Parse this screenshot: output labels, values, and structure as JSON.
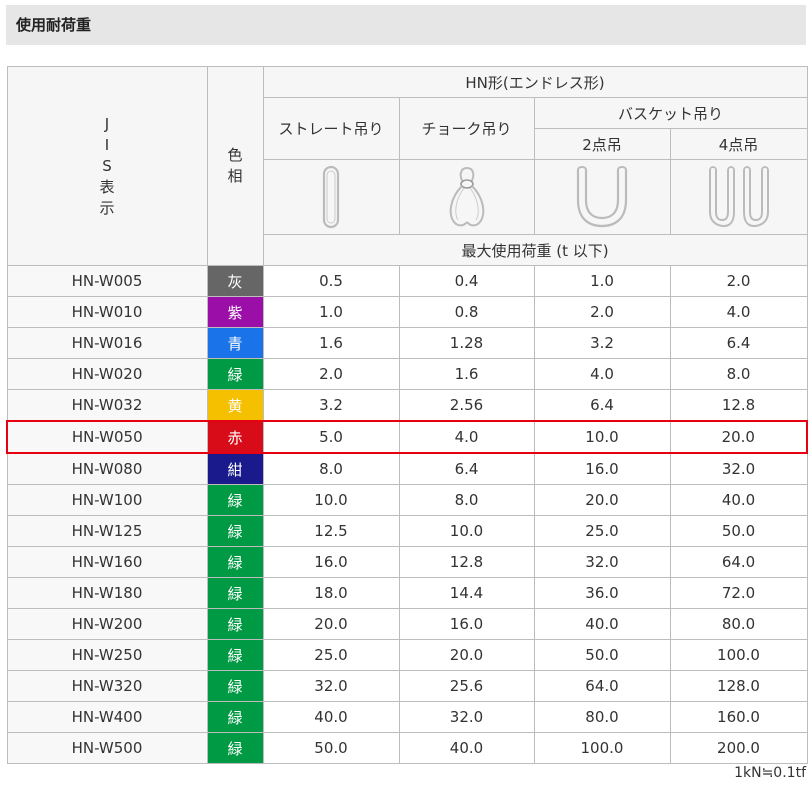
{
  "section": {
    "title": "使用耐荷重"
  },
  "table": {
    "header": {
      "jis_chars": [
        "J",
        "I",
        "S",
        "表",
        "示"
      ],
      "color_chars": [
        "色",
        "相"
      ],
      "group": "HN形(エンドレス形)",
      "straight": "ストレート吊り",
      "choke": "チョーク吊り",
      "basket": "バスケット吊り",
      "two_point": "2点吊",
      "four_point": "4点吊",
      "max_load": "最大使用荷重 (t 以下)"
    },
    "icons": {
      "straight": "straight-sling-icon",
      "choke": "choke-sling-icon",
      "basket2": "basket-two-point-icon",
      "basket4": "basket-four-point-icon"
    },
    "highlight_row": 5,
    "highlight_color": "#e60012",
    "rows": [
      {
        "model": "HN-W005",
        "color": "灰",
        "hex": "#666666",
        "straight": "0.5",
        "choke": "0.4",
        "b2": "1.0",
        "b4": "2.0"
      },
      {
        "model": "HN-W010",
        "color": "紫",
        "hex": "#9b0fa8",
        "straight": "1.0",
        "choke": "0.8",
        "b2": "2.0",
        "b4": "4.0"
      },
      {
        "model": "HN-W016",
        "color": "青",
        "hex": "#1a73e8",
        "straight": "1.6",
        "choke": "1.28",
        "b2": "3.2",
        "b4": "6.4"
      },
      {
        "model": "HN-W020",
        "color": "緑",
        "hex": "#009944",
        "straight": "2.0",
        "choke": "1.6",
        "b2": "4.0",
        "b4": "8.0"
      },
      {
        "model": "HN-W032",
        "color": "黄",
        "hex": "#f5c000",
        "straight": "3.2",
        "choke": "2.56",
        "b2": "6.4",
        "b4": "12.8"
      },
      {
        "model": "HN-W050",
        "color": "赤",
        "hex": "#d80c18",
        "straight": "5.0",
        "choke": "4.0",
        "b2": "10.0",
        "b4": "20.0"
      },
      {
        "model": "HN-W080",
        "color": "紺",
        "hex": "#1a1a8c",
        "straight": "8.0",
        "choke": "6.4",
        "b2": "16.0",
        "b4": "32.0"
      },
      {
        "model": "HN-W100",
        "color": "緑",
        "hex": "#009944",
        "straight": "10.0",
        "choke": "8.0",
        "b2": "20.0",
        "b4": "40.0"
      },
      {
        "model": "HN-W125",
        "color": "緑",
        "hex": "#009944",
        "straight": "12.5",
        "choke": "10.0",
        "b2": "25.0",
        "b4": "50.0"
      },
      {
        "model": "HN-W160",
        "color": "緑",
        "hex": "#009944",
        "straight": "16.0",
        "choke": "12.8",
        "b2": "32.0",
        "b4": "64.0"
      },
      {
        "model": "HN-W180",
        "color": "緑",
        "hex": "#009944",
        "straight": "18.0",
        "choke": "14.4",
        "b2": "36.0",
        "b4": "72.0"
      },
      {
        "model": "HN-W200",
        "color": "緑",
        "hex": "#009944",
        "straight": "20.0",
        "choke": "16.0",
        "b2": "40.0",
        "b4": "80.0"
      },
      {
        "model": "HN-W250",
        "color": "緑",
        "hex": "#009944",
        "straight": "25.0",
        "choke": "20.0",
        "b2": "50.0",
        "b4": "100.0"
      },
      {
        "model": "HN-W320",
        "color": "緑",
        "hex": "#009944",
        "straight": "32.0",
        "choke": "25.6",
        "b2": "64.0",
        "b4": "128.0"
      },
      {
        "model": "HN-W400",
        "color": "緑",
        "hex": "#009944",
        "straight": "40.0",
        "choke": "32.0",
        "b2": "80.0",
        "b4": "160.0"
      },
      {
        "model": "HN-W500",
        "color": "緑",
        "hex": "#009944",
        "straight": "50.0",
        "choke": "40.0",
        "b2": "100.0",
        "b4": "200.0"
      }
    ]
  },
  "footnote": "1kN≒0.1tf"
}
